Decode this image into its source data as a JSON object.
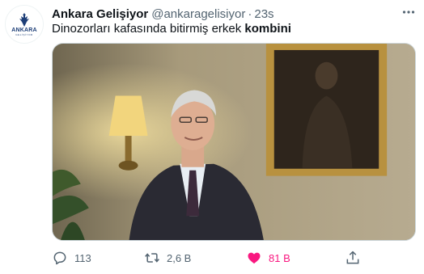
{
  "author": {
    "name": "Ankara Gelişiyor",
    "handle": "@ankaragelisiyor",
    "time": "23s",
    "avatar_text": "ANKARA",
    "avatar_subtext": "GELİŞİYOR"
  },
  "tweet": {
    "text_plain": "Dinozorları kafasında bitirmiş erkek ",
    "text_bold": "kombini"
  },
  "metrics": {
    "replies": "113",
    "retweets": "2,6 B",
    "likes": "81 B"
  },
  "colors": {
    "like_active": "#f91880",
    "muted": "#536471",
    "brand": "#1d3e77"
  },
  "icons": [
    "more-icon",
    "reply-icon",
    "retweet-icon",
    "heart-icon",
    "share-icon"
  ]
}
